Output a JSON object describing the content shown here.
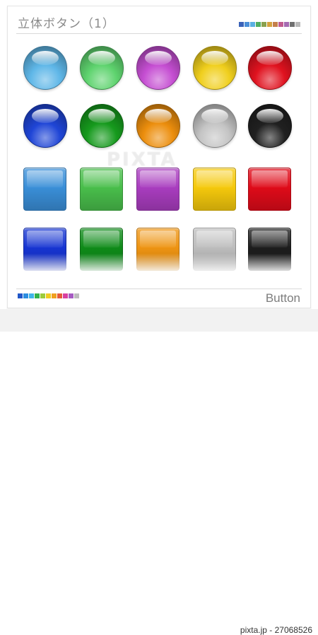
{
  "header": {
    "title": "立体ボタン（1）",
    "swatch_colors": [
      "#3a62b8",
      "#4a8fd8",
      "#59b0e3",
      "#4fae62",
      "#8aa14d",
      "#d5a23d",
      "#c47f4b",
      "#c05a8f",
      "#a56bb2",
      "#6f6f6f",
      "#b8b8b8"
    ]
  },
  "footer": {
    "label": "Button",
    "swatch_colors": [
      "#2157c8",
      "#2c8de0",
      "#40b5e8",
      "#33b34a",
      "#9ccb3b",
      "#f1cc20",
      "#f0a020",
      "#e55a3a",
      "#d840a0",
      "#a65bc2",
      "#bcbcbc"
    ]
  },
  "watermark": {
    "text": "PIXTA"
  },
  "credit": {
    "text": "pixta.jp - 27068526"
  },
  "rows": [
    {
      "shape": "sphere",
      "buttons": [
        {
          "name": "light-blue-sphere-button",
          "color": "#5fb7e8"
        },
        {
          "name": "light-green-sphere-button",
          "color": "#5ed36e"
        },
        {
          "name": "purple-sphere-button",
          "color": "#c54ed2"
        },
        {
          "name": "yellow-sphere-button",
          "color": "#f0cf1d"
        },
        {
          "name": "red-sphere-button",
          "color": "#e0121f"
        }
      ]
    },
    {
      "shape": "sphere",
      "buttons": [
        {
          "name": "blue-sphere-button",
          "color": "#1f45d6"
        },
        {
          "name": "green-sphere-button",
          "color": "#169a1d"
        },
        {
          "name": "orange-sphere-button",
          "color": "#ec8e0d"
        },
        {
          "name": "silver-sphere-button",
          "color": "#c4c4c4"
        },
        {
          "name": "black-sphere-button",
          "color": "#202020"
        }
      ]
    },
    {
      "shape": "square",
      "buttons": [
        {
          "name": "light-blue-square-button",
          "color": "#3a8fd8"
        },
        {
          "name": "light-green-square-button",
          "color": "#49be4b"
        },
        {
          "name": "purple-square-button",
          "color": "#a93dbf"
        },
        {
          "name": "yellow-square-button",
          "color": "#f5c90c"
        },
        {
          "name": "red-square-button",
          "color": "#df0b19"
        }
      ]
    },
    {
      "shape": "square",
      "buttons": [
        {
          "name": "blue-square-button",
          "color": "#1735d2"
        },
        {
          "name": "green-square-button",
          "color": "#0f8b19"
        },
        {
          "name": "orange-square-button",
          "color": "#ee9412"
        },
        {
          "name": "silver-square-button",
          "color": "#bdbdbd"
        },
        {
          "name": "black-square-button",
          "color": "#1d1d1d"
        }
      ]
    }
  ]
}
